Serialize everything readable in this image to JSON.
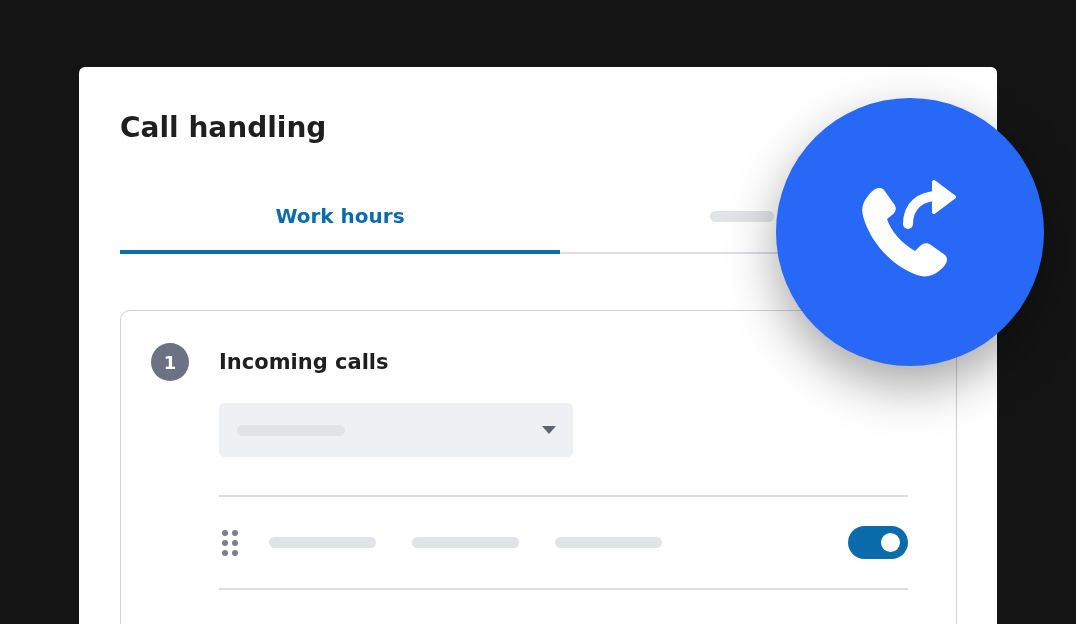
{
  "title": "Call handling",
  "tabs": [
    {
      "label": "Work hours",
      "selected": true
    },
    {
      "selected": false
    }
  ],
  "step": {
    "number": "1",
    "title": "Incoming calls"
  },
  "rules": [
    {
      "on": true
    }
  ]
}
